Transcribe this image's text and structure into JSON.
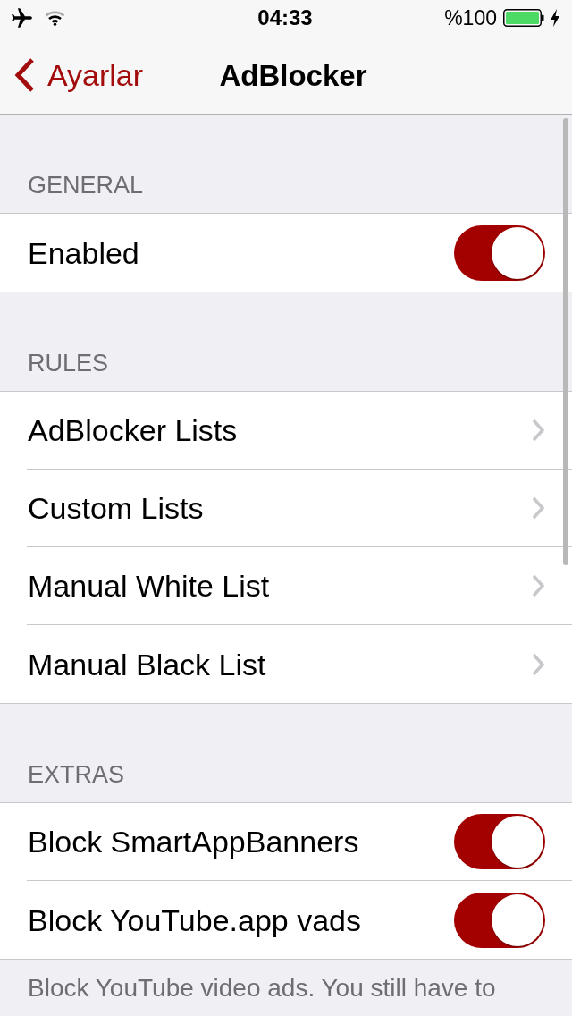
{
  "status_bar": {
    "time": "04:33",
    "battery": "%100"
  },
  "nav_bar": {
    "back": "Ayarlar",
    "title": "AdBlocker"
  },
  "sections": [
    {
      "header": "GENERAL",
      "rows": [
        {
          "kind": "toggle",
          "label": "Enabled",
          "on": true
        }
      ]
    },
    {
      "header": "RULES",
      "rows": [
        {
          "kind": "link",
          "label": "AdBlocker Lists"
        },
        {
          "kind": "link",
          "label": "Custom Lists"
        },
        {
          "kind": "link",
          "label": "Manual White List"
        },
        {
          "kind": "link",
          "label": "Manual Black List"
        }
      ]
    },
    {
      "header": "EXTRAS",
      "rows": [
        {
          "kind": "toggle",
          "label": "Block SmartAppBanners",
          "on": true
        },
        {
          "kind": "toggle",
          "label": "Block YouTube.app vads",
          "on": true
        }
      ],
      "footer": "Block YouTube video ads. You still have to"
    }
  ]
}
